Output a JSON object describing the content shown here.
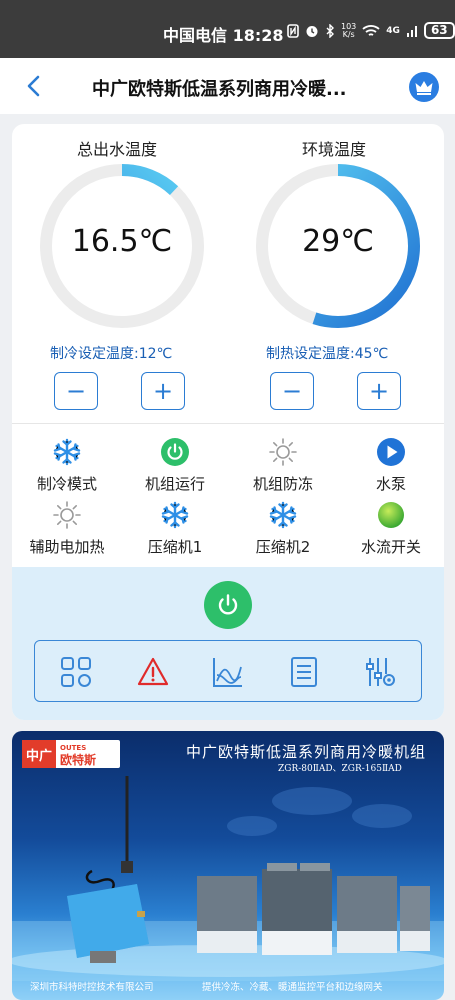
{
  "status_bar": {
    "carrier_time": "中国电信 18:28",
    "speed_value": "103",
    "speed_unit": "K/s",
    "network": "4G",
    "battery": "63"
  },
  "header": {
    "title": "中广欧特斯低温系列商用冷暖..."
  },
  "gauges": {
    "left": {
      "label": "总出水温度",
      "value": "16.5℃",
      "fill_fraction": 0.12
    },
    "right": {
      "label": "环境温度",
      "value": "29℃",
      "fill_fraction": 0.55
    }
  },
  "setpoints": {
    "cooling": "制冷设定温度:12℃",
    "heating": "制热设定温度:45℃",
    "minus": "−",
    "plus": "+"
  },
  "status_items": [
    {
      "label": "制冷模式",
      "icon": "snowflake-icon"
    },
    {
      "label": "机组运行",
      "icon": "power-icon"
    },
    {
      "label": "机组防冻",
      "icon": "sun-icon"
    },
    {
      "label": "水泵",
      "icon": "play-icon"
    },
    {
      "label": "辅助电加热",
      "icon": "sun-icon"
    },
    {
      "label": "压缩机1",
      "icon": "snowflake-icon"
    },
    {
      "label": "压缩机2",
      "icon": "snowflake-icon"
    },
    {
      "label": "水流开关",
      "icon": "green-dot-icon"
    }
  ],
  "colors": {
    "accent": "#2b7cd3",
    "gauge_gradient_start": "#1f6fd1",
    "gauge_gradient_end": "#5ed3f5",
    "power_green": "#2dbf6a",
    "alarm_red": "#e02b2b"
  },
  "banner": {
    "logo_cn": "中广",
    "logo_en": "OUTES",
    "logo_brand": "欧特斯",
    "title": "中广欧特斯低温系列商用冷暖机组",
    "models": "ZGR-80ⅡAD、ZGR-165ⅡAD",
    "footer_left": "深圳市科特时控技术有限公司",
    "footer_right": "提供冷冻、冷藏、暖通监控平台和边缘网关"
  }
}
